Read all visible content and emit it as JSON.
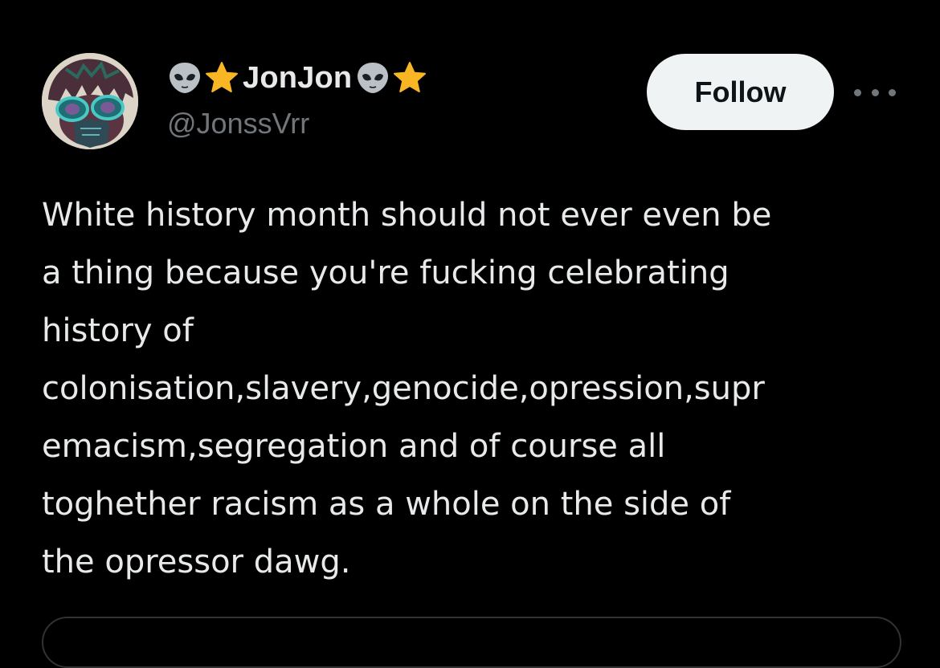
{
  "post": {
    "author": {
      "display_name": "JonJon",
      "handle": "@JonssVrr",
      "name_emojis": [
        "alien-icon",
        "star-icon",
        "alien-icon",
        "star-icon"
      ]
    },
    "follow_label": "Follow",
    "more_icon": "more-horizontal-icon",
    "text_lines": [
      "White history month should not ever even be",
      "a thing because you're fucking celebrating",
      "history of",
      "colonisation,slavery,genocide,opression,supr",
      "emacism,segregation and of course all",
      "toghether racism as a whole on the side of",
      "the opressor dawg."
    ]
  },
  "colors": {
    "background": "#000000",
    "text_primary": "#e7e9ea",
    "text_secondary": "#71767b",
    "follow_bg": "#eff3f4",
    "follow_text": "#0f1419",
    "star": "#f9b624",
    "alien": "#b9c1c6"
  }
}
